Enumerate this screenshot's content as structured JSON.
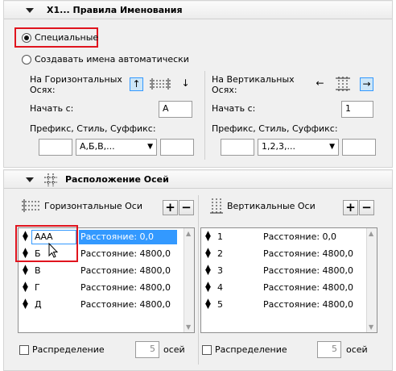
{
  "naming": {
    "header": "Х1... Правила Именования",
    "option_custom": "Специальные",
    "option_auto": "Создавать имена автоматически",
    "horiz": {
      "axes_label": "На Горизонтальных Осях:",
      "start_label": "Начать с:",
      "start_value": "А",
      "prefix_label": "Префикс, Стиль, Суффикс:",
      "style_value": "А,Б,В,..."
    },
    "vert": {
      "axes_label": "На Вертикальных Осях:",
      "start_label": "Начать с:",
      "start_value": "1",
      "prefix_label": "Префикс, Стиль, Суффикс:",
      "style_value": "1,2,3,..."
    }
  },
  "layout": {
    "header": "Расположение Осей",
    "horizontal": {
      "title": "Горизонтальные Оси",
      "rows": [
        {
          "name": "ААА",
          "dist": "Расстояние: 0,0"
        },
        {
          "name": "Б",
          "dist": "Расстояние: 4800,0"
        },
        {
          "name": "В",
          "dist": "Расстояние: 4800,0"
        },
        {
          "name": "Г",
          "dist": "Расстояние: 4800,0"
        },
        {
          "name": "Д",
          "dist": "Расстояние: 4800,0"
        }
      ],
      "distribution_label": "Распределение",
      "count": "5",
      "axes_word": "осей"
    },
    "vertical": {
      "title": "Вертикальные Оси",
      "rows": [
        {
          "name": "1",
          "dist": "Расстояние: 0,0"
        },
        {
          "name": "2",
          "dist": "Расстояние: 4800,0"
        },
        {
          "name": "3",
          "dist": "Расстояние: 4800,0"
        },
        {
          "name": "4",
          "dist": "Расстояние: 4800,0"
        },
        {
          "name": "5",
          "dist": "Расстояние: 4800,0"
        }
      ],
      "distribution_label": "Распределение",
      "count": "5",
      "axes_word": "осей"
    }
  },
  "icons": {
    "plus": "+",
    "minus": "−"
  }
}
